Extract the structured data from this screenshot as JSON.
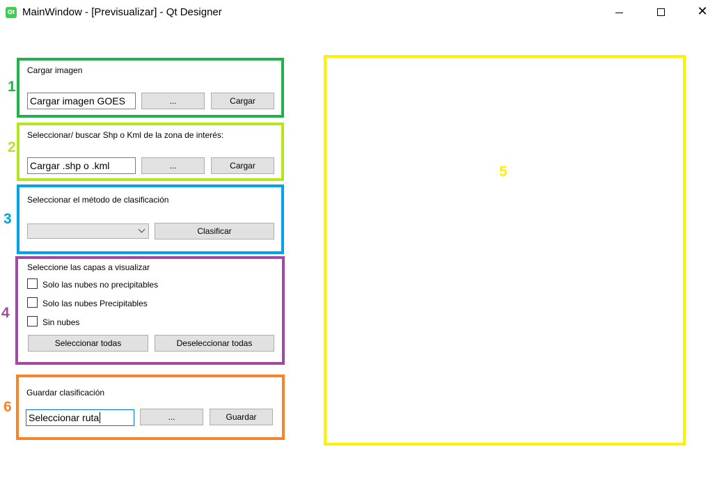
{
  "window": {
    "title": "MainWindow - [Previsualizar] - Qt Designer",
    "app_icon_text": "Qt",
    "close_glyph": "✕"
  },
  "colors": {
    "section1": "#22b14c",
    "section2": "#b5e61d",
    "section3": "#00a2e8",
    "section4": "#a349a4",
    "section5": "#fff200",
    "section6": "#f7832a"
  },
  "sections": {
    "s1": {
      "number": "1",
      "label": "Cargar imagen",
      "input_value": "Cargar imagen GOES",
      "browse_label": "...",
      "load_label": "Cargar"
    },
    "s2": {
      "number": "2",
      "label": "Seleccionar/ buscar Shp o Kml de la zona de interés:",
      "input_value": "Cargar .shp o .kml",
      "browse_label": "...",
      "load_label": "Cargar"
    },
    "s3": {
      "number": "3",
      "label": "Seleccionar el método de clasificación",
      "combo_value": "",
      "classify_label": "Clasificar"
    },
    "s4": {
      "number": "4",
      "label": "Seleccione las capas a visualizar",
      "checkboxes": [
        {
          "label": "Solo las nubes no precipitables",
          "checked": false
        },
        {
          "label": "Solo las nubes Precipitables",
          "checked": false
        },
        {
          "label": "Sin nubes",
          "checked": false
        }
      ],
      "select_all_label": "Seleccionar todas",
      "deselect_all_label": "Deseleccionar todas"
    },
    "s5": {
      "number": "5"
    },
    "s6": {
      "number": "6",
      "label": "Guardar clasificación",
      "input_value": "Seleccionar ruta",
      "browse_label": "...",
      "save_label": "Guardar"
    }
  }
}
